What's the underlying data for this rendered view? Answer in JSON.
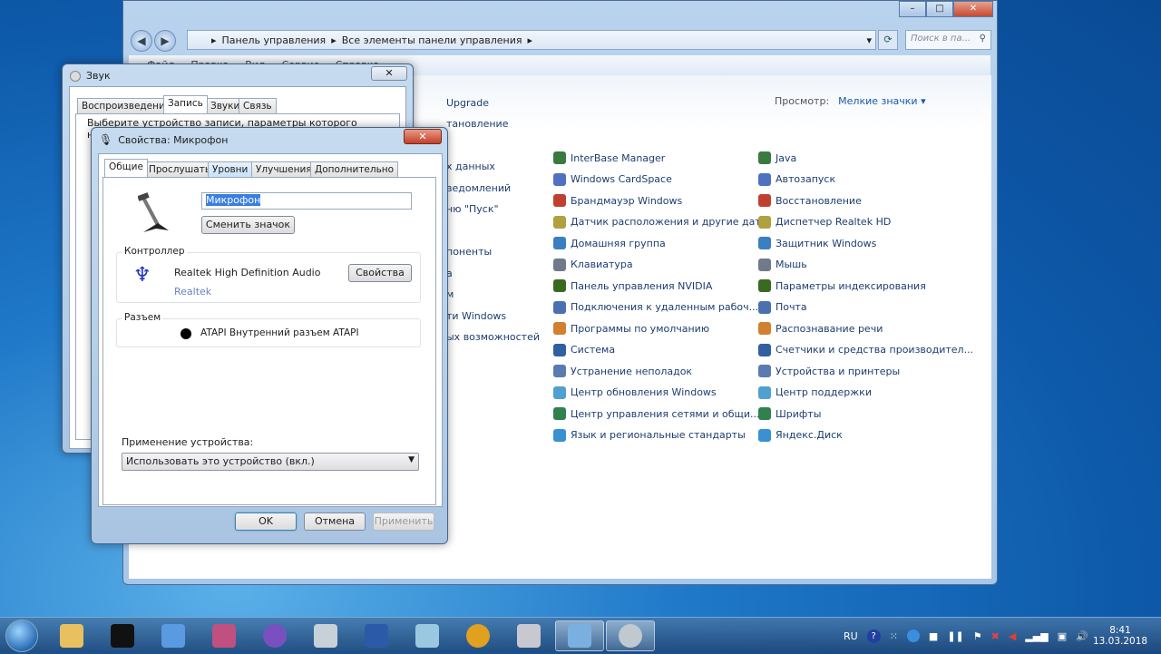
{
  "control_panel": {
    "breadcrumb": [
      "Панель управления",
      "Все элементы панели управления"
    ],
    "search_placeholder": "Поиск в па...",
    "menu": [
      "Файл",
      "Правка",
      "Вид",
      "Сервис",
      "Справка"
    ],
    "view_label": "Просмотр:",
    "view_value": "Мелкие значки",
    "left_partial": [
      "Upgrade",
      "тановление",
      "",
      "х данных",
      "ведомлений",
      "ню \"Пуск\"",
      "",
      "поненты",
      "а",
      "м",
      "ти Windows",
      "ых возможностей"
    ],
    "col2": [
      "InterBase Manager",
      "Windows CardSpace",
      "Брандмауэр Windows",
      "Датчик расположения и другие дат...",
      "Домашняя группа",
      "Клавиатура",
      "Панель управления NVIDIA",
      "Подключения к удаленным рабоч...",
      "Программы по умолчанию",
      "Система",
      "Устранение неполадок",
      "Центр обновления Windows",
      "Центр управления сетями и общи...",
      "Язык и региональные стандарты"
    ],
    "col3": [
      "Java",
      "Автозапуск",
      "Восстановление",
      "Диспетчер Realtek HD",
      "Защитник Windows",
      "Мышь",
      "Параметры индексирования",
      "Почта",
      "Распознавание речи",
      "Счетчики и средства производител...",
      "Устройства и принтеры",
      "Центр поддержки",
      "Шрифты",
      "Яндекс.Диск"
    ]
  },
  "sound": {
    "title": "Звук",
    "tabs": [
      "Воспроизведение",
      "Запись",
      "Звуки",
      "Связь"
    ],
    "text": "Выберите устройство записи, параметры которого нужно"
  },
  "mic": {
    "title": "Свойства: Микрофон",
    "tabs": [
      "Общие",
      "Прослушать",
      "Уровни",
      "Улучшения",
      "Дополнительно"
    ],
    "name_value": "Микрофон",
    "change_icon": "Сменить значок",
    "controller_label": "Контроллер",
    "controller_name": "Realtek High Definition Audio",
    "controller_vendor": "Realtek",
    "properties_btn": "Свойства",
    "jack_label": "Разъем",
    "jack_text": "ATAPI Внутренний разъем ATAPI",
    "usage_label": "Применение устройства:",
    "usage_value": "Использовать это устройство (вкл.)",
    "ok": "OK",
    "cancel": "Отмена",
    "apply": "Применить"
  },
  "taskbar": {
    "lang": "RU",
    "time": "8:41",
    "date": "13.03.2018"
  }
}
